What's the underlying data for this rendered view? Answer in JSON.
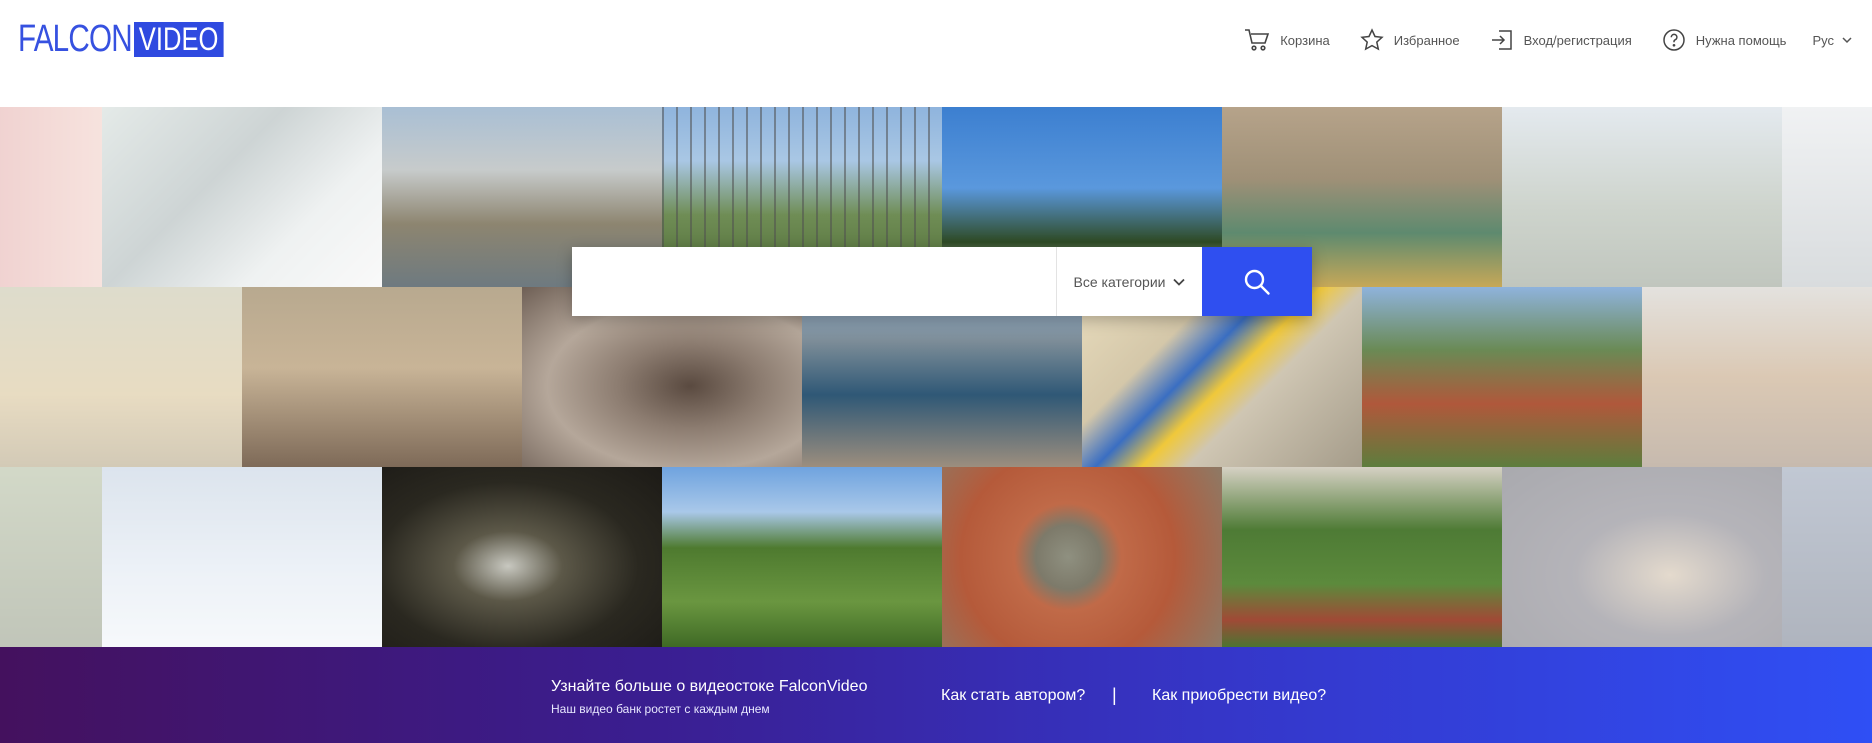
{
  "logo": {
    "text": "FALCON",
    "badge": "VIDEO"
  },
  "nav": {
    "cart": "Корзина",
    "favorites": "Избранное",
    "login": "Вход/регистрация",
    "help": "Нужна помощь",
    "language": "Рус"
  },
  "search": {
    "placeholder": "",
    "value": "",
    "category": "Все категории"
  },
  "band": {
    "title": "Узнайте больше о видеостоке FalconVideo",
    "subtitle": "Наш видео банк ростет с каждым днем",
    "link_author": "Как стать автором?",
    "separator": "|",
    "link_buy": "Как приобрести видео?"
  },
  "colors": {
    "brand_blue": "#2f4ae0",
    "search_button": "#2f4ff0",
    "band_start": "#44115e",
    "band_end": "#2f4ff5"
  },
  "icons": {
    "cart": "cart-icon",
    "favorites": "star-icon",
    "login": "login-icon",
    "help": "help-icon",
    "lang": "chevron-down-icon",
    "search": "search-icon"
  }
}
